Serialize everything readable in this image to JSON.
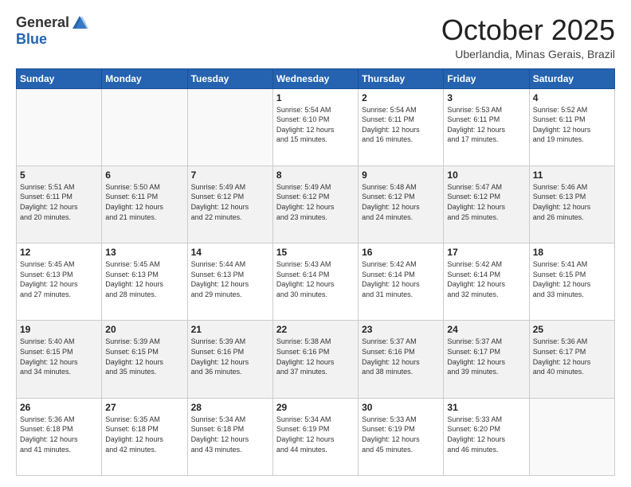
{
  "header": {
    "logo_general": "General",
    "logo_blue": "Blue",
    "month": "October 2025",
    "location": "Uberlandia, Minas Gerais, Brazil"
  },
  "days_of_week": [
    "Sunday",
    "Monday",
    "Tuesday",
    "Wednesday",
    "Thursday",
    "Friday",
    "Saturday"
  ],
  "weeks": [
    [
      {
        "day": "",
        "info": ""
      },
      {
        "day": "",
        "info": ""
      },
      {
        "day": "",
        "info": ""
      },
      {
        "day": "1",
        "info": "Sunrise: 5:54 AM\nSunset: 6:10 PM\nDaylight: 12 hours\nand 15 minutes."
      },
      {
        "day": "2",
        "info": "Sunrise: 5:54 AM\nSunset: 6:11 PM\nDaylight: 12 hours\nand 16 minutes."
      },
      {
        "day": "3",
        "info": "Sunrise: 5:53 AM\nSunset: 6:11 PM\nDaylight: 12 hours\nand 17 minutes."
      },
      {
        "day": "4",
        "info": "Sunrise: 5:52 AM\nSunset: 6:11 PM\nDaylight: 12 hours\nand 19 minutes."
      }
    ],
    [
      {
        "day": "5",
        "info": "Sunrise: 5:51 AM\nSunset: 6:11 PM\nDaylight: 12 hours\nand 20 minutes."
      },
      {
        "day": "6",
        "info": "Sunrise: 5:50 AM\nSunset: 6:11 PM\nDaylight: 12 hours\nand 21 minutes."
      },
      {
        "day": "7",
        "info": "Sunrise: 5:49 AM\nSunset: 6:12 PM\nDaylight: 12 hours\nand 22 minutes."
      },
      {
        "day": "8",
        "info": "Sunrise: 5:49 AM\nSunset: 6:12 PM\nDaylight: 12 hours\nand 23 minutes."
      },
      {
        "day": "9",
        "info": "Sunrise: 5:48 AM\nSunset: 6:12 PM\nDaylight: 12 hours\nand 24 minutes."
      },
      {
        "day": "10",
        "info": "Sunrise: 5:47 AM\nSunset: 6:12 PM\nDaylight: 12 hours\nand 25 minutes."
      },
      {
        "day": "11",
        "info": "Sunrise: 5:46 AM\nSunset: 6:13 PM\nDaylight: 12 hours\nand 26 minutes."
      }
    ],
    [
      {
        "day": "12",
        "info": "Sunrise: 5:45 AM\nSunset: 6:13 PM\nDaylight: 12 hours\nand 27 minutes."
      },
      {
        "day": "13",
        "info": "Sunrise: 5:45 AM\nSunset: 6:13 PM\nDaylight: 12 hours\nand 28 minutes."
      },
      {
        "day": "14",
        "info": "Sunrise: 5:44 AM\nSunset: 6:13 PM\nDaylight: 12 hours\nand 29 minutes."
      },
      {
        "day": "15",
        "info": "Sunrise: 5:43 AM\nSunset: 6:14 PM\nDaylight: 12 hours\nand 30 minutes."
      },
      {
        "day": "16",
        "info": "Sunrise: 5:42 AM\nSunset: 6:14 PM\nDaylight: 12 hours\nand 31 minutes."
      },
      {
        "day": "17",
        "info": "Sunrise: 5:42 AM\nSunset: 6:14 PM\nDaylight: 12 hours\nand 32 minutes."
      },
      {
        "day": "18",
        "info": "Sunrise: 5:41 AM\nSunset: 6:15 PM\nDaylight: 12 hours\nand 33 minutes."
      }
    ],
    [
      {
        "day": "19",
        "info": "Sunrise: 5:40 AM\nSunset: 6:15 PM\nDaylight: 12 hours\nand 34 minutes."
      },
      {
        "day": "20",
        "info": "Sunrise: 5:39 AM\nSunset: 6:15 PM\nDaylight: 12 hours\nand 35 minutes."
      },
      {
        "day": "21",
        "info": "Sunrise: 5:39 AM\nSunset: 6:16 PM\nDaylight: 12 hours\nand 36 minutes."
      },
      {
        "day": "22",
        "info": "Sunrise: 5:38 AM\nSunset: 6:16 PM\nDaylight: 12 hours\nand 37 minutes."
      },
      {
        "day": "23",
        "info": "Sunrise: 5:37 AM\nSunset: 6:16 PM\nDaylight: 12 hours\nand 38 minutes."
      },
      {
        "day": "24",
        "info": "Sunrise: 5:37 AM\nSunset: 6:17 PM\nDaylight: 12 hours\nand 39 minutes."
      },
      {
        "day": "25",
        "info": "Sunrise: 5:36 AM\nSunset: 6:17 PM\nDaylight: 12 hours\nand 40 minutes."
      }
    ],
    [
      {
        "day": "26",
        "info": "Sunrise: 5:36 AM\nSunset: 6:18 PM\nDaylight: 12 hours\nand 41 minutes."
      },
      {
        "day": "27",
        "info": "Sunrise: 5:35 AM\nSunset: 6:18 PM\nDaylight: 12 hours\nand 42 minutes."
      },
      {
        "day": "28",
        "info": "Sunrise: 5:34 AM\nSunset: 6:18 PM\nDaylight: 12 hours\nand 43 minutes."
      },
      {
        "day": "29",
        "info": "Sunrise: 5:34 AM\nSunset: 6:19 PM\nDaylight: 12 hours\nand 44 minutes."
      },
      {
        "day": "30",
        "info": "Sunrise: 5:33 AM\nSunset: 6:19 PM\nDaylight: 12 hours\nand 45 minutes."
      },
      {
        "day": "31",
        "info": "Sunrise: 5:33 AM\nSunset: 6:20 PM\nDaylight: 12 hours\nand 46 minutes."
      },
      {
        "day": "",
        "info": ""
      }
    ]
  ]
}
